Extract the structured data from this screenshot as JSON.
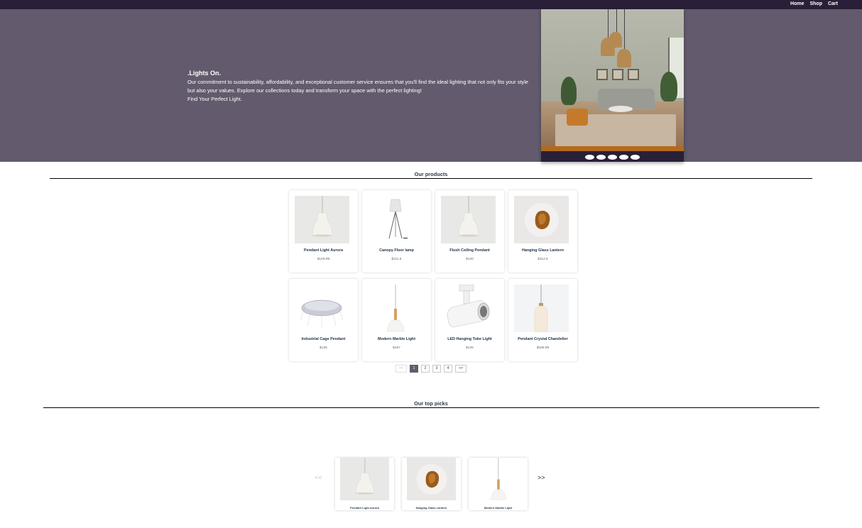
{
  "nav": {
    "links": [
      "Home",
      "Shop",
      "Cart"
    ]
  },
  "hero": {
    "title": ".Lights On.",
    "description": "Our commitment to sustainability, affordability, and exceptional customer service ensures that you'll find the ideal lighting that not only fits your style but also your values. Explore our collections today and transform your space with the perfect lighting!",
    "cta": "Find Your Perfect Light.",
    "slide_count": 5
  },
  "products_section": {
    "title": "Our products",
    "products": [
      {
        "name": "Pendant Light Aurora",
        "price": "$129.99",
        "icon": "white-pendant-lamp"
      },
      {
        "name": "Canopy Floor lamp",
        "price": "$111.5",
        "icon": "tripod-floor-lamp"
      },
      {
        "name": "Flush Ceiling Pendant",
        "price": "$120",
        "icon": "white-pendant-lamp"
      },
      {
        "name": "Hanging Glass Lantern",
        "price": "$112.5",
        "icon": "amber-glass-lantern"
      },
      {
        "name": "Industrial Cage Pendant",
        "price": "$135",
        "icon": "disc-cage-pendant"
      },
      {
        "name": "Modern Marble Light",
        "price": "$157",
        "icon": "marble-pendant-light"
      },
      {
        "name": "LED Hanging Tube Light",
        "price": "$125",
        "icon": "track-spotlight"
      },
      {
        "name": "Pendant Crystal Chandelier",
        "price": "$188.99",
        "icon": "capsule-pendant"
      }
    ]
  },
  "pagination": {
    "prev": "<<",
    "pages": [
      "1",
      "2",
      "3",
      "4"
    ],
    "next": ">>",
    "current": "1"
  },
  "top_picks": {
    "title": "Our top picks",
    "prev": "<<",
    "next": ">>",
    "items": [
      {
        "name": "Pendant Light Aurora",
        "icon": "white-pendant-lamp"
      },
      {
        "name": "Hanging Glass Lantern",
        "icon": "amber-glass-lantern"
      },
      {
        "name": "Modern Marble Light",
        "icon": "marble-pendant-light"
      }
    ]
  },
  "colors": {
    "nav_bg": "#2a1f38",
    "hero_bg": "#635b6d",
    "title_text": "#1f3147"
  }
}
